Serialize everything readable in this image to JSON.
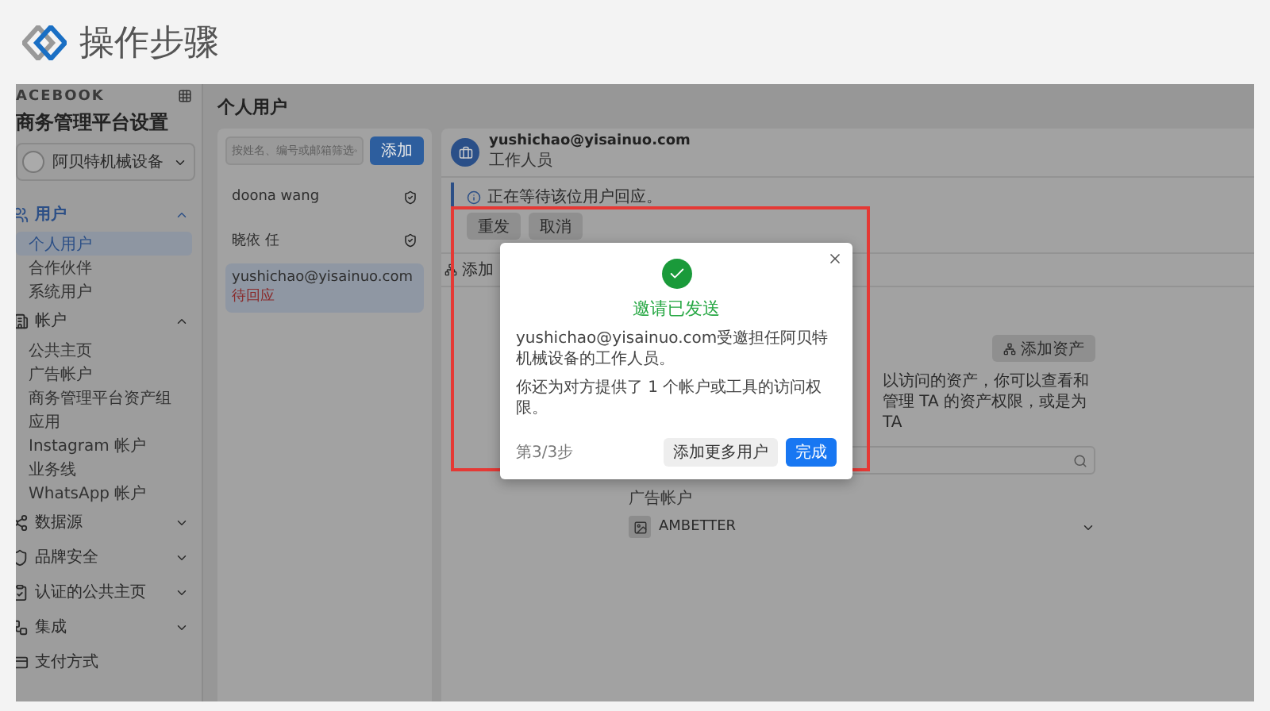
{
  "header": {
    "title": "操作步骤"
  },
  "sidebar": {
    "brand": "ACEBOOK",
    "title": "商务管理平台设置",
    "business": "阿贝特机械设备",
    "sections": [
      {
        "label": "用户",
        "expanded": true,
        "selected": true,
        "children": [
          {
            "label": "个人用户",
            "selected": true
          },
          {
            "label": "合作伙伴",
            "selected": false
          },
          {
            "label": "系统用户",
            "selected": false
          }
        ]
      },
      {
        "label": "帐户",
        "expanded": true,
        "selected": false,
        "children": [
          {
            "label": "公共主页",
            "selected": false
          },
          {
            "label": "广告帐户",
            "selected": false
          },
          {
            "label": "商务管理平台资产组",
            "selected": false
          },
          {
            "label": "应用",
            "selected": false
          },
          {
            "label": "Instagram 帐户",
            "selected": false
          },
          {
            "label": "业务线",
            "selected": false
          },
          {
            "label": "WhatsApp 帐户",
            "selected": false
          }
        ]
      },
      {
        "label": "数据源",
        "expanded": false,
        "selected": false
      },
      {
        "label": "品牌安全",
        "expanded": false,
        "selected": false
      },
      {
        "label": "认证的公共主页",
        "expanded": false,
        "selected": false
      },
      {
        "label": "集成",
        "expanded": false,
        "selected": false
      },
      {
        "label": "支付方式",
        "selected": false
      }
    ]
  },
  "page_title": "个人用户",
  "user_list": {
    "search": {
      "placeholder": "按姓名、编号或邮箱筛选"
    },
    "add_button": "添加",
    "users": [
      {
        "name": "doona wang",
        "selected": false
      },
      {
        "name": "晓依 任",
        "selected": false
      },
      {
        "name": "yushichao@yisainuo.com",
        "status": "待回应",
        "selected": true
      }
    ]
  },
  "detail": {
    "email": "yushichao@yisainuo.com",
    "role": "工作人员",
    "notice": "正在等待该位用户回应。",
    "notice_buttons": [
      "重发",
      "取消"
    ],
    "tab": "添加",
    "add_asset_button": "添加资产",
    "description": "以访问的资产，你可以查看和管理 TA 的资产权限，或是为 TA",
    "group_label": "广告帐户",
    "asset": "AMBETTER"
  },
  "dialog": {
    "title": "邀请已发送",
    "lines": [
      "yushichao@yisainuo.com受邀担任阿贝特机械设备的工作人员。",
      "你还为对方提供了 1 个帐户或工具的访问权限。"
    ],
    "step": "第3/3步",
    "buttons": [
      {
        "label": "添加更多用户",
        "primary": false
      },
      {
        "label": "完成",
        "primary": true
      }
    ]
  }
}
